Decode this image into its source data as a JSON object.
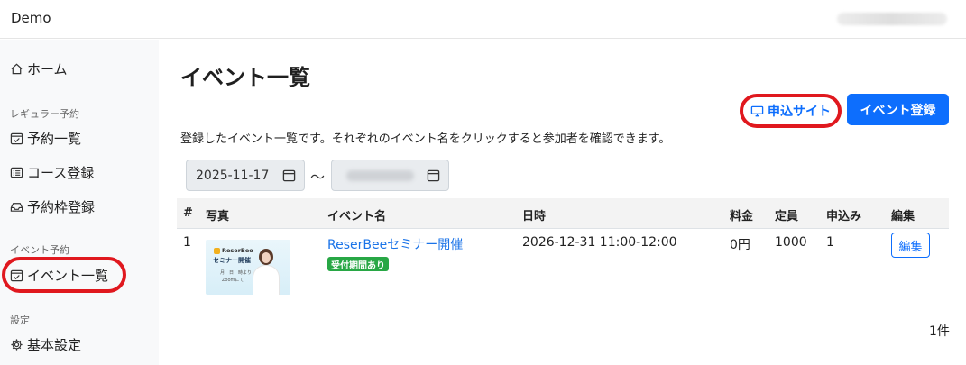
{
  "app": {
    "brand": "Demo"
  },
  "sidebar": {
    "home": "ホーム",
    "section_regular": "レギュラー予約",
    "reservation_list": "予約一覧",
    "course_register": "コース登録",
    "slot_register": "予約枠登録",
    "section_event": "イベント予約",
    "event_list": "イベント一覧",
    "section_settings": "設定",
    "basic_settings": "基本設定"
  },
  "main": {
    "title": "イベント一覧",
    "description": "登録したイベント一覧です。それぞれのイベント名をクリックすると参加者を確認できます。",
    "apply_site_label": "申込サイト",
    "register_event_label": "イベント登録",
    "date_from": "2025-11-17",
    "date_separator": "〜",
    "count_label": "1件"
  },
  "table": {
    "headers": [
      "#",
      "写真",
      "イベント名",
      "日時",
      "料金",
      "定員",
      "申込み",
      "編集"
    ],
    "rows": [
      {
        "no": "1",
        "name": "ReserBeeセミナー開催",
        "badge": "受付期間あり",
        "datetime": "2026-12-31 11:00-12:00",
        "fee": "0円",
        "capacity": "1000",
        "applications": "1",
        "edit_label": "編集",
        "thumbnail": {
          "brand": "ReserBee",
          "title": "セミナー開催",
          "date_line": "月　日　時より",
          "venue": "Zoomにて"
        }
      }
    ]
  },
  "colors": {
    "accent": "#0d6efd",
    "highlight": "#e0181e",
    "badge": "#28a745"
  }
}
